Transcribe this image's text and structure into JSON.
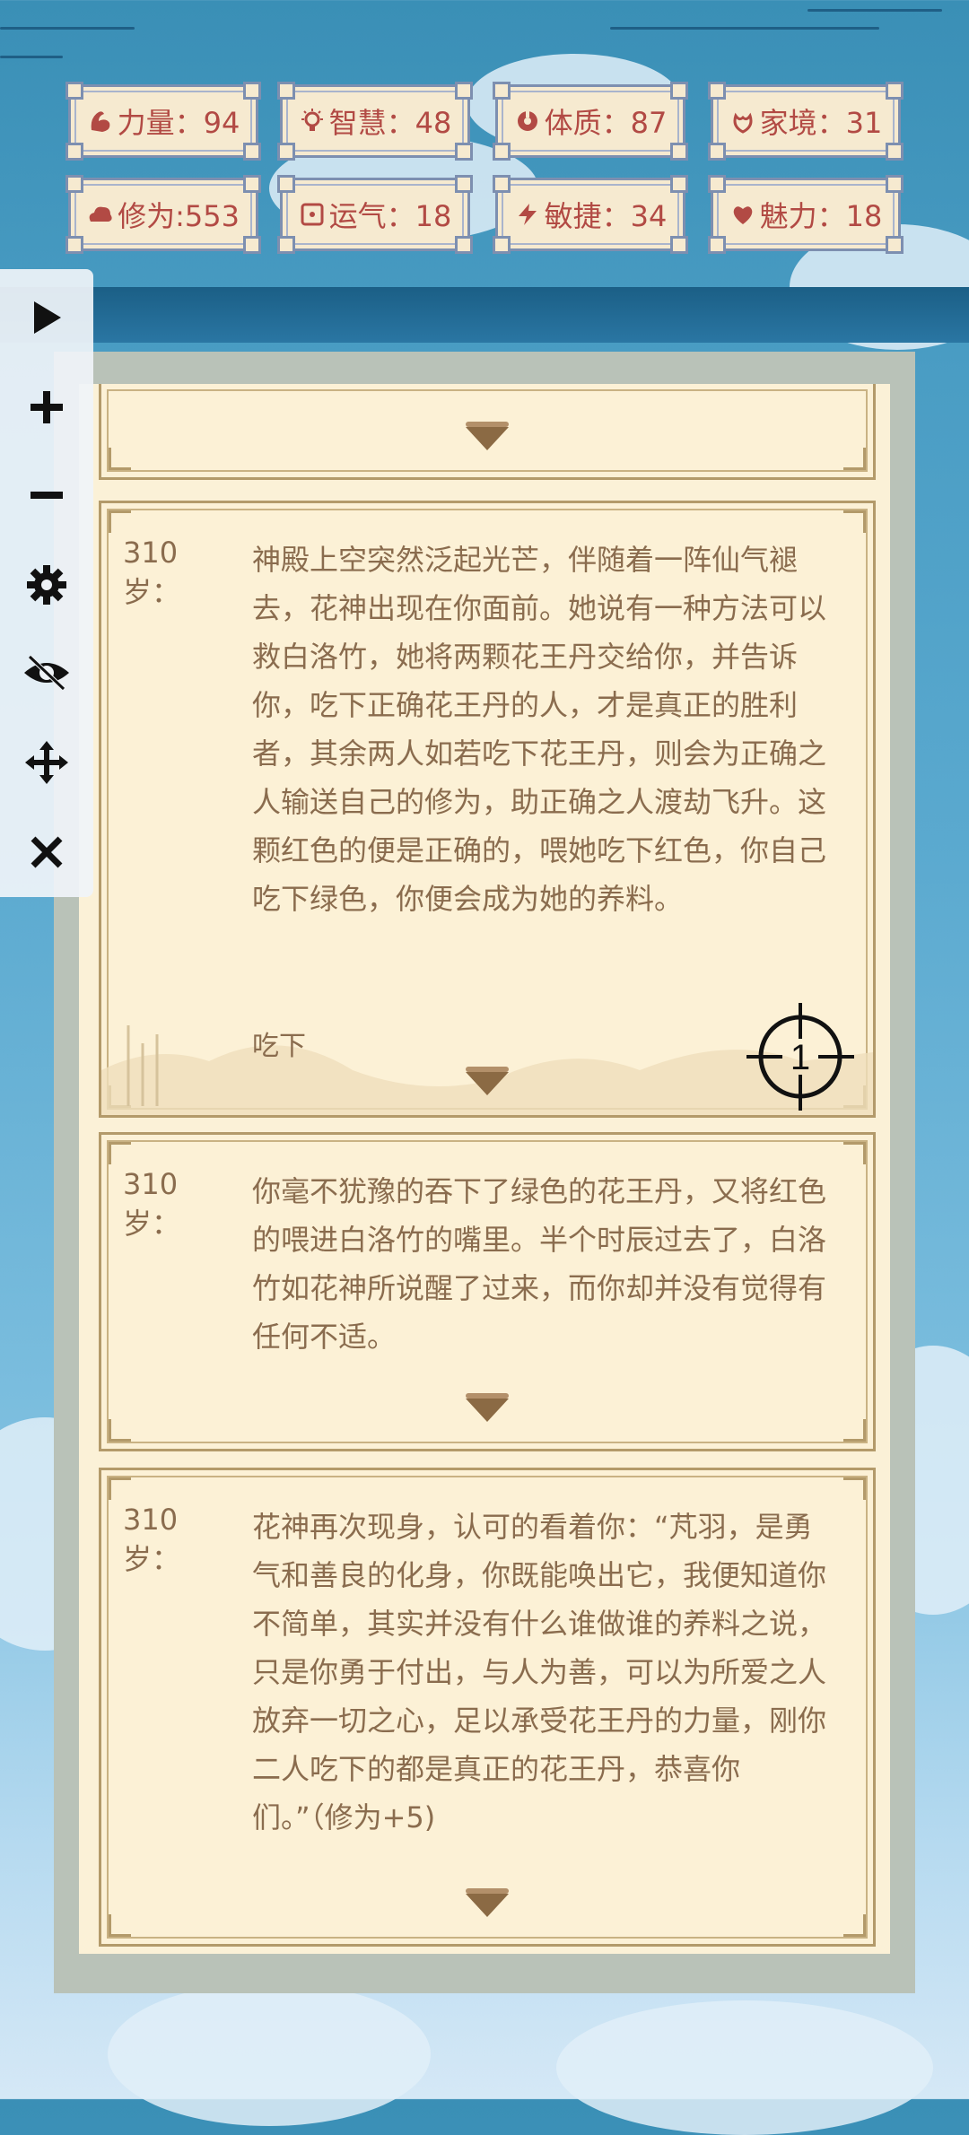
{
  "stats": [
    {
      "icon": "strength-icon",
      "label": "力量：94"
    },
    {
      "icon": "wisdom-icon",
      "label": "智慧：48"
    },
    {
      "icon": "constitution-icon",
      "label": "体质：87"
    },
    {
      "icon": "family-icon",
      "label": "家境：31"
    },
    {
      "icon": "cultivation-icon",
      "label": "修为:553"
    },
    {
      "icon": "luck-icon",
      "label": "运气：18"
    },
    {
      "icon": "agility-icon",
      "label": "敏捷：34"
    },
    {
      "icon": "charm-icon",
      "label": "魅力：18"
    }
  ],
  "toolbar": [
    "play-icon",
    "zoom-in-icon",
    "zoom-out-icon",
    "settings-icon",
    "hide-icon",
    "move-icon",
    "close-icon"
  ],
  "events": [
    {
      "age": "310岁：",
      "text": "神殿上空突然泛起光芒，伴随着一阵仙气褪去，花神出现在你面前。她说有一种方法可以救白洛竹，她将两颗花王丹交给你，并告诉你，吃下正确花王丹的人，才是真正的胜利者，其余两人如若吃下花王丹，则会为正确之人输送自己的修为，助正确之人渡劫飞升。这颗红色的便是正确的，喂她吃下红色，你自己吃下绿色，你便会成为她的养料。",
      "choice": "吃下"
    },
    {
      "age": "310岁：",
      "text": "你毫不犹豫的吞下了绿色的花王丹，又将红色的喂进白洛竹的嘴里。半个时辰过去了，白洛竹如花神所说醒了过来，而你却并没有觉得有任何不适。"
    },
    {
      "age": "310岁：",
      "text": "花神再次现身，认可的看着你：“芃羽，是勇气和善良的化身，你既能唤出它，我便知道你不简单，其实并没有什么谁做谁的养料之说，只是你勇于付出，与人为善，可以为所爱之人放弃一切之心，足以承受花王丹的力量，刚你二人吃下的都是真正的花王丹，恭喜你们。”（修为+5)"
    }
  ],
  "crosshair_label": "1",
  "colors": {
    "stat_text": "#b24a44",
    "card_text": "#8a6c4e",
    "card_border": "#b39a6a"
  }
}
